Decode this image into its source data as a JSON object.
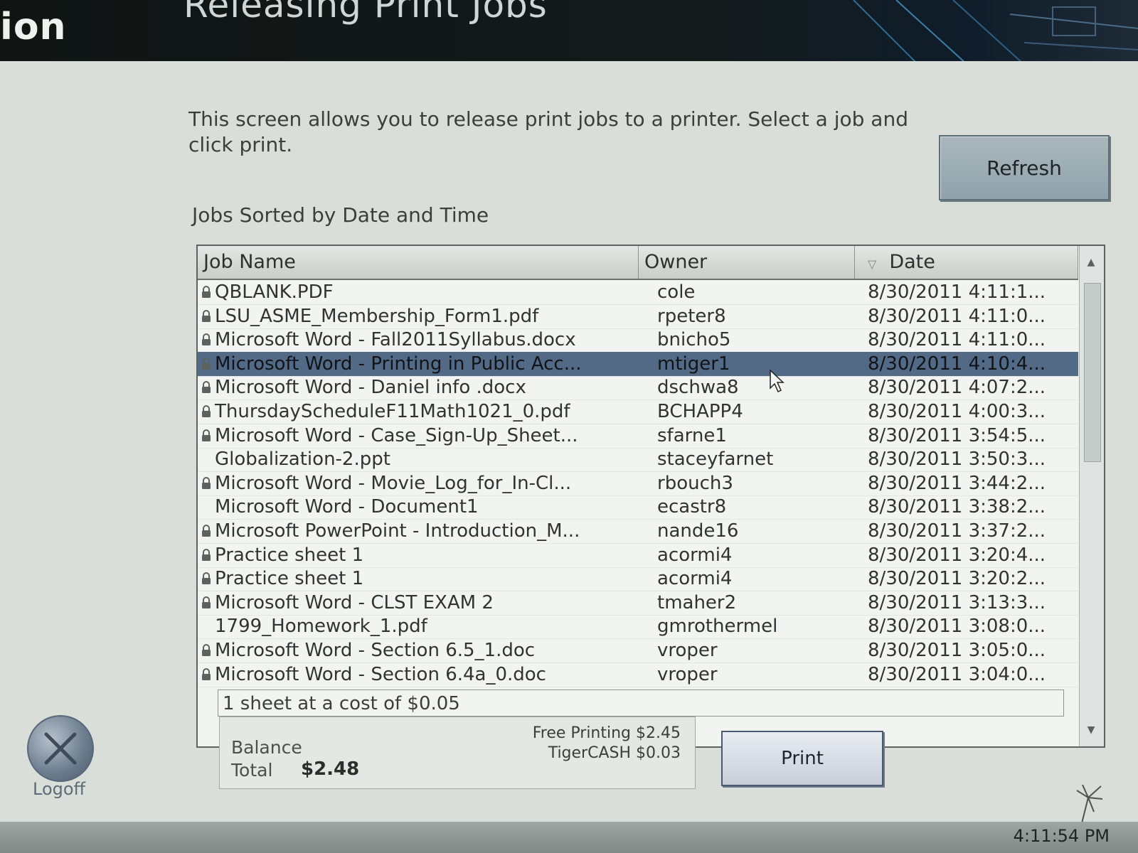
{
  "header": {
    "app_title_fragment": "ion",
    "page_title": "Releasing Print Jobs"
  },
  "instructions": "This screen allows you to release print jobs to a printer. Select a job and click print.",
  "refresh_label": "Refresh",
  "section_title": "Jobs Sorted by Date and Time",
  "table": {
    "columns": [
      "Job Name",
      "Owner",
      "Date"
    ],
    "sort_column": "Date",
    "rows": [
      {
        "name": "QBLANK.PDF",
        "owner": "cole",
        "date": "8/30/2011 4:11:1...",
        "locked": true
      },
      {
        "name": "LSU_ASME_Membership_Form1.pdf",
        "owner": "rpeter8",
        "date": "8/30/2011 4:11:0...",
        "locked": true
      },
      {
        "name": "Microsoft Word - Fall2011Syllabus.docx",
        "owner": "bnicho5",
        "date": "8/30/2011 4:11:0...",
        "locked": true
      },
      {
        "name": "Microsoft Word - Printing in Public Acc...",
        "owner": "mtiger1",
        "date": "8/30/2011 4:10:4...",
        "locked": true,
        "selected": true
      },
      {
        "name": "Microsoft Word - Daniel info .docx",
        "owner": "dschwa8",
        "date": "8/30/2011 4:07:2...",
        "locked": true
      },
      {
        "name": "ThursdayScheduleF11Math1021_0.pdf",
        "owner": "BCHAPP4",
        "date": "8/30/2011 4:00:3...",
        "locked": true
      },
      {
        "name": "Microsoft Word - Case_Sign-Up_Sheet...",
        "owner": "sfarne1",
        "date": "8/30/2011 3:54:5...",
        "locked": true
      },
      {
        "name": "Globalization-2.ppt",
        "owner": "staceyfarnet",
        "date": "8/30/2011 3:50:3...",
        "locked": false
      },
      {
        "name": "Microsoft Word - Movie_Log_for_In-Cl...",
        "owner": "rbouch3",
        "date": "8/30/2011 3:44:2...",
        "locked": true
      },
      {
        "name": "Microsoft Word - Document1",
        "owner": "ecastr8",
        "date": "8/30/2011 3:38:2...",
        "locked": false
      },
      {
        "name": "Microsoft PowerPoint - Introduction_M...",
        "owner": "nande16",
        "date": "8/30/2011 3:37:2...",
        "locked": true
      },
      {
        "name": "Practice sheet 1",
        "owner": "acormi4",
        "date": "8/30/2011 3:20:4...",
        "locked": true
      },
      {
        "name": "Practice sheet 1",
        "owner": "acormi4",
        "date": "8/30/2011 3:20:2...",
        "locked": true
      },
      {
        "name": "Microsoft Word - CLST EXAM 2",
        "owner": "tmaher2",
        "date": "8/30/2011 3:13:3...",
        "locked": true
      },
      {
        "name": "1799_Homework_1.pdf",
        "owner": "gmrothermel",
        "date": "8/30/2011 3:08:0...",
        "locked": false
      },
      {
        "name": "Microsoft Word - Section 6.5_1.doc",
        "owner": "vroper",
        "date": "8/30/2011 3:05:0...",
        "locked": true
      },
      {
        "name": "Microsoft Word - Section 6.4a_0.doc",
        "owner": "vroper",
        "date": "8/30/2011 3:04:0...",
        "locked": true
      }
    ]
  },
  "cost_line": "1 sheet at a cost of $0.05",
  "balance": {
    "balance_label": "Balance",
    "total_label": "Total",
    "total_value": "$2.48",
    "free_printing": "Free Printing $2.45",
    "tiger_cash": "TigerCASH $0.03"
  },
  "print_label": "Print",
  "logoff_label": "Logoff",
  "clock": "4:11:54 PM",
  "colors": {
    "selected_row": "#536a86",
    "background": "#d9dfd8",
    "header_bar": "#141a1a"
  }
}
